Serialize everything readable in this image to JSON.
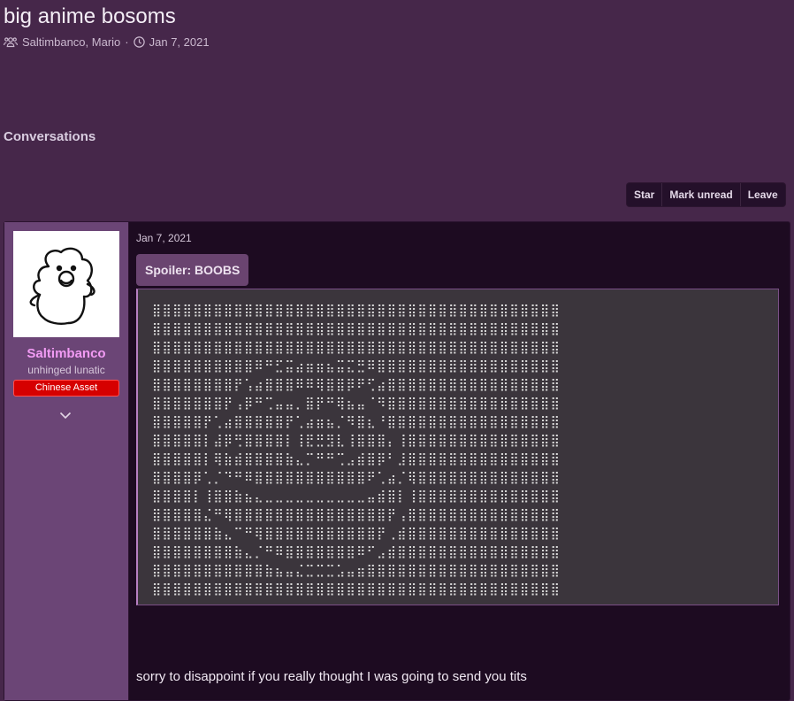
{
  "conversation": {
    "title": "big anime bosoms",
    "participants": "Saltimbanco, Mario",
    "separator": "·",
    "date": "Jan 7, 2021"
  },
  "section": {
    "title": "Conversations"
  },
  "actions": {
    "star": "Star",
    "mark_unread": "Mark unread",
    "leave": "Leave"
  },
  "message": {
    "date": "Jan 7, 2021",
    "author": {
      "name": "Saltimbanco",
      "title": "unhinged lunatic",
      "banner": "Chinese Asset",
      "banner_color": "#d60000",
      "name_color": "#f29bf4"
    },
    "spoiler_label": "Spoiler: BOOBS",
    "ascii_art": "⣿⣿⣿⣿⣿⣿⣿⣿⣿⣿⣿⣿⣿⣿⣿⣿⣿⣿⣿⣿⣿⣿⣿⣿⣿⣿⣿⣿⣿⣿⣿⣿⣿⣿⣿⣿⣿⣿⣿⣿\n⣿⣿⣿⣿⣿⣿⣿⣿⣿⣿⣿⣿⣿⣿⣿⣿⣿⣿⣿⣿⣿⣿⣿⣿⣿⣿⣿⣿⣿⣿⣿⣿⣿⣿⣿⣿⣿⣿⣿⣿\n⣿⣿⣿⣿⣿⣿⣿⣿⣿⣿⣿⣿⣿⣿⣿⣿⣿⣿⣿⣿⣿⣿⣿⣿⣿⣿⣿⣿⣿⣿⣿⣿⣿⣿⣿⣿⣿⣿⣿⣿\n⣿⣿⣿⣿⣿⣿⣿⣿⣿⣿⠿⠛⣋⣭⣴⣶⣶⣦⣭⣍⣛⠿⣿⣿⣿⣿⣿⣿⣿⣿⣿⣿⣿⣿⣿⣿⣿⣿⣿⣿\n⣿⣿⣿⣿⣿⣿⣿⣿⡟⢡⣴⣿⣿⣿⠿⠿⢿⣿⣿⡿⠟⢋⣴⣿⣿⣿⣿⣿⣿⣿⣿⣿⣿⣿⣿⣿⣿⣿⣿⣿\n⣿⣿⣿⣿⣿⣿⣿⡟⢠⡿⠛⢉⣤⣤⡀⣿⡟⠛⢿⣦⣤⠈⠻⣿⣿⣿⣿⣿⣿⣿⣿⣿⣿⣿⣿⣿⣿⣿⣿⣿\n⣿⣿⣿⣿⣿⡟⢁⣴⣿⣿⣿⣿⣿⡟⢁⣴⣶⣦⡈⠻⣿⣆⠘⣿⣿⣿⣿⣿⣿⣿⣿⣿⣿⣿⣿⣿⣿⣿⣿⣿\n⣿⣿⣿⣿⣿⡇⣼⡿⢛⣿⣿⣿⣿⡇⢸⣟⣛⣻⣇⢸⣿⣿⣿⡄⢸⣿⣿⣿⣿⣿⣿⣿⣿⣿⣿⣿⣿⣿⣿⣿\n⣿⣿⣿⣿⣿⡇⢿⣷⣾⣿⣿⣿⣿⣷⣄⡉⠛⠛⢉⣠⣾⣿⡿⠃⣸⣿⣿⣿⣿⣿⣿⣿⣿⣿⣿⣿⣿⣿⣿⣿\n⣿⣿⣿⣿⡿⢁⡈⠙⠛⠿⣿⣿⣿⣿⣿⣿⣿⣿⣿⣿⣿⠟⢁⣴⡈⢿⣿⣿⣿⣿⣿⣿⣿⣿⣿⣿⣿⣿⣿⣿\n⣿⣿⣿⣿⡇⢸⣿⣿⣷⣦⣄⣀⣀⣀⣀⣀⣀⣀⣀⣀⣀⣤⣾⣿⡇⢸⣿⣿⣿⣿⣿⣿⣿⣿⣿⣿⣿⣿⣿⣿\n⣿⣿⣿⣿⣿⣌⠛⢿⣿⣿⣿⣿⣿⣿⣿⣿⣿⣿⣿⣿⣿⣿⣿⡟⢠⣿⣿⣿⣿⣿⣿⣿⣿⣿⣿⣿⣿⣿⣿⣿\n⣿⣿⣿⣿⣿⣿⣷⣄⠉⠛⢿⣿⣿⣿⣿⣿⣿⣿⣿⣿⣿⣿⡟⢀⣾⣿⣿⣿⣿⣿⣿⣿⣿⣿⣿⣿⣿⣿⣿⣿\n⣿⣿⣿⣿⣿⣿⣿⣿⣷⣄⡈⠛⠿⣿⣿⣿⣿⣿⣿⣿⠿⠋⣠⣾⣿⣿⣿⣿⣿⣿⣿⣿⣿⣿⣿⣿⣿⣿⣿⣿\n⣿⣿⣿⣿⣿⣿⣿⣿⣿⣿⣿⣷⣦⣤⣌⣉⣉⣉⣡⣤⣶⣿⣿⣿⣿⣿⣿⣿⣿⣿⣿⣿⣿⣿⣿⣿⣿⣿⣿⣿\n⣿⣿⣿⣿⣿⣿⣿⣿⣿⣿⣿⣿⣿⣿⣿⣿⣿⣿⣿⣿⣿⣿⣿⣿⣿⣿⣿⣿⣿⣿⣿⣿⣿⣿⣿⣿⣿⣿⣿⣿",
    "text": "sorry to disappoint if you really thought I was going to send you tits"
  },
  "icons": {
    "participants": "users-icon",
    "date": "clock-icon",
    "expand": "chevron-down-icon"
  },
  "colors": {
    "page_bg": "#46274a",
    "message_bg": "#1d0b21",
    "sidebar_bg": "#6b4576",
    "spoiler_bg": "#3b353c"
  }
}
